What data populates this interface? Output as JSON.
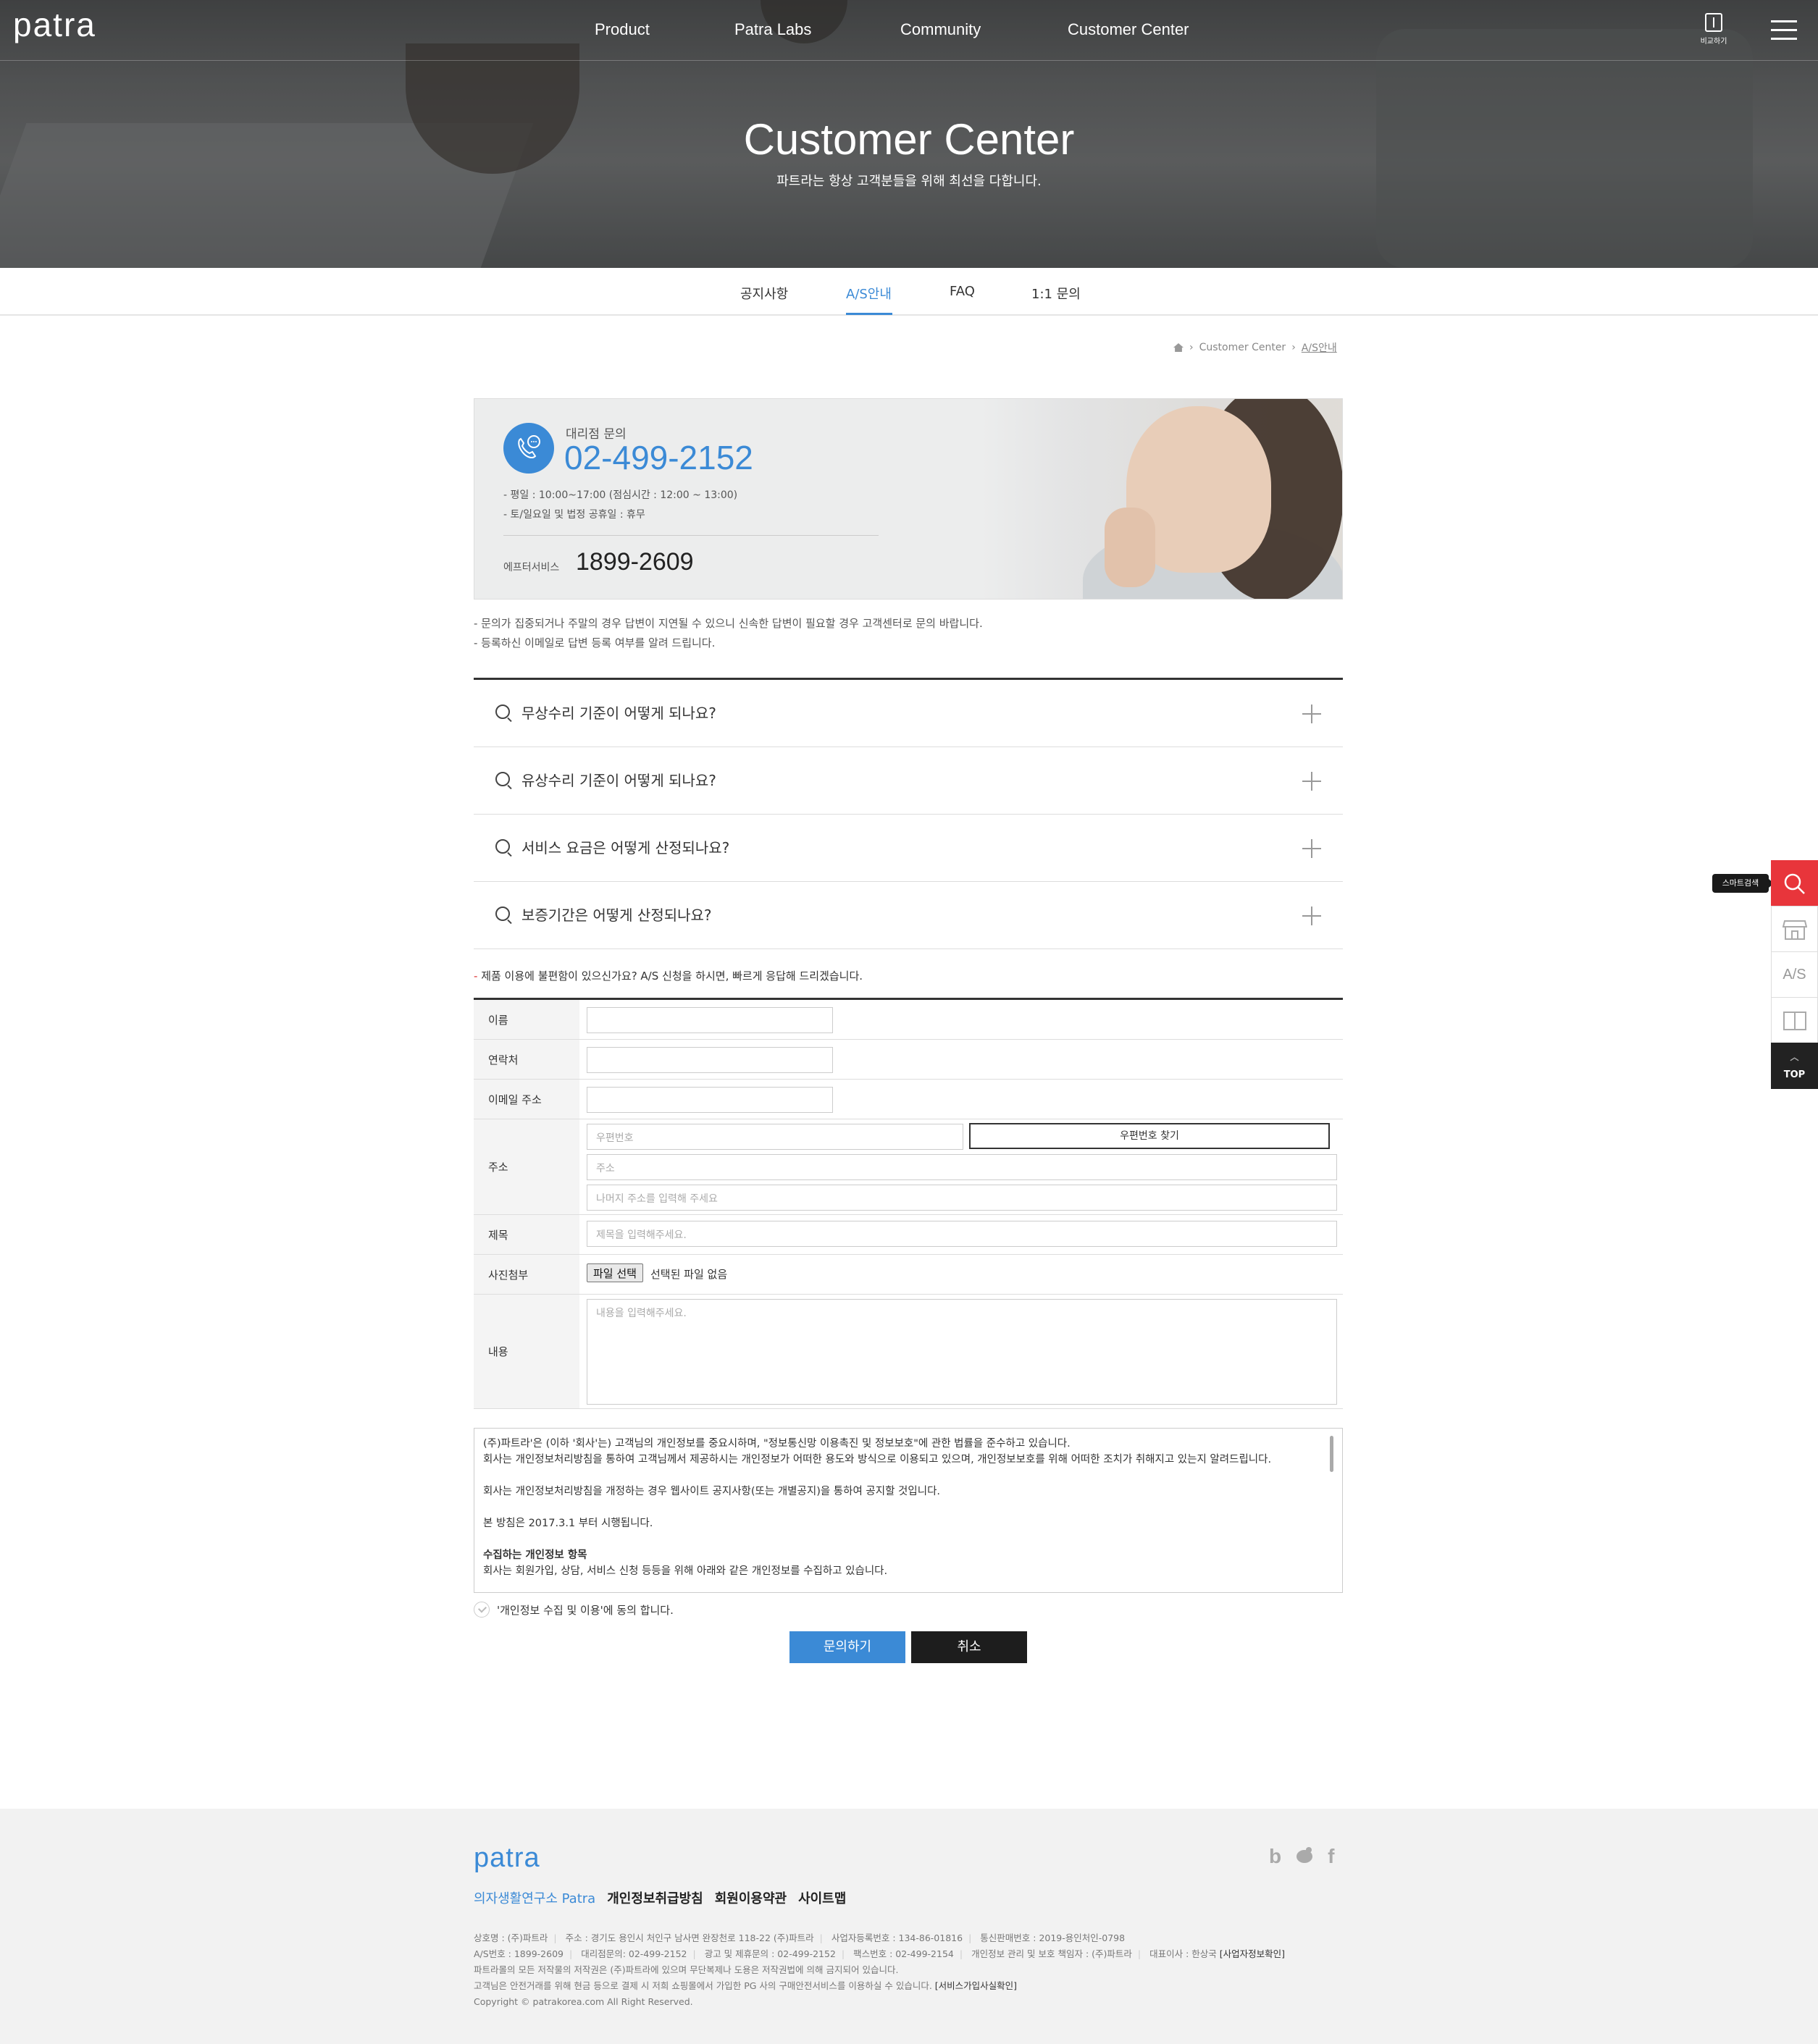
{
  "header": {
    "logo": "patra",
    "nav": [
      "Product",
      "Patra Labs",
      "Community",
      "Customer Center"
    ],
    "compare_label": "비교하기"
  },
  "hero": {
    "title": "Customer Center",
    "subtitle": "파트라는 항상 고객분들을 위해 최선을 다합니다."
  },
  "subnav": {
    "tabs": [
      "공지사항",
      "A/S안내",
      "FAQ",
      "1:1 문의"
    ],
    "active": "A/S안내"
  },
  "breadcrumb": [
    "Customer Center",
    "A/S안내"
  ],
  "contact": {
    "label": "대리점 문의",
    "phone": "02-499-2152",
    "hours_weekday": "- 평일 : 10:00~17:00 (점심시간 : 12:00 ~ 13:00)",
    "hours_weekend": "- 토/일요일 및 법정 공휴일 : 휴무",
    "after_label": "에프터서비스",
    "after_phone": "1899-2609"
  },
  "notes": [
    "- 문의가 집중되거나 주말의 경우 답변이 지연될 수 있으니 신속한 답변이 필요할 경우 고객센터로 문의 바랍니다.",
    "- 등록하신 이메일로 답변 등록 여부를 알려 드립니다."
  ],
  "faq": [
    "무상수리 기준이 어떻게 되나요?",
    "유상수리 기준이 어떻게 되나요?",
    "서비스 요금은 어떻게 산정되나요?",
    "보증기간은 어떻게 산정되나요?"
  ],
  "form": {
    "intro_dash": "-",
    "intro": " 제품 이용에 불편함이 있으신가요? A/S 신청을 하시면, 빠르게 응답해 드리겠습니다.",
    "name_label": "이름",
    "phone_label": "연락처",
    "email_label": "이메일 주소",
    "address_label": "주소",
    "zip_placeholder": "우편번호",
    "zip_button": "우편번호 찾기",
    "address_placeholder": "주소",
    "address_detail_placeholder": "나머지 주소를 입력해 주세요",
    "subject_label": "제목",
    "subject_placeholder": "제목을 입력해주세요.",
    "photo_label": "사진첨부",
    "file_button": "파일 선택",
    "file_none": "선택된 파일 없음",
    "content_label": "내용",
    "content_placeholder": "내용을 입력해주세요."
  },
  "policy": {
    "line1": "(주)파트라'은 (이하 '회사'는) 고객님의 개인정보를 중요시하며, \"정보통신망 이용촉진 및 정보보호\"에 관한 법률을 준수하고 있습니다.",
    "line2": "회사는 개인정보처리방침을 통하여 고객님께서 제공하시는 개인정보가 어떠한 용도와 방식으로 이용되고 있으며, 개인정보보호를 위해 어떠한 조치가 취해지고 있는지 알려드립니다.",
    "line3": "회사는 개인정보처리방침을 개정하는 경우 웹사이트 공지사항(또는 개별공지)을 통하여 공지할 것입니다.",
    "line4": "본 방침은 2017.3.1 부터 시행됩니다.",
    "heading": "수집하는 개인정보 항목",
    "line5": "회사는 회원가입, 상담, 서비스 신청 등등을 위해 아래와 같은 개인정보를 수집하고 있습니다."
  },
  "agree_label": "'개인정보 수집 및 이용'에 동의 합니다.",
  "buttons": {
    "submit": "문의하기",
    "cancel": "취소"
  },
  "quick": {
    "tooltip": "스마트검색",
    "as_label": "A/S",
    "top_label": "TOP"
  },
  "footer": {
    "logo": "patra",
    "sns": [
      "b",
      "f"
    ],
    "links": [
      "의자생활연구소 Patra",
      "개인정보취급방침",
      "회원이용약관",
      "사이트맵"
    ],
    "info1": [
      "상호명 : (주)파트라",
      "주소 : 경기도 용인시 처인구 남사면 완장천로 118-22 (주)파트라",
      "사업자등록번호 : 134-86-01816",
      "통신판매번호 : 2019-용인처인-0798"
    ],
    "info2": [
      "A/S번호 : 1899-2609",
      "대리점문의: 02-499-2152",
      "광고 및 제휴문의 : 02-499-2152",
      "팩스번호 : 02-499-2154",
      "개인정보 관리 및 보호 책임자 : (주)파트라",
      "대표이사 : 한상국"
    ],
    "info2_link": "[사업자정보확인]",
    "info3": "파트라몰의 모든 저작물의 저작권은 (주)파트라에 있으며 무단복제나 도용은 저작권법에 의해 금지되어 있습니다.",
    "info4": "고객님은 안전거래를 위해 현금 등으로 결제 시 저희 쇼핑몰에서 가입한 PG 사의 구매안전서비스를 이용하실 수 있습니다.",
    "info4_link": "[서비스가입사실확인]",
    "copyright": "Copyright © patrakorea.com All Right Reserved."
  }
}
